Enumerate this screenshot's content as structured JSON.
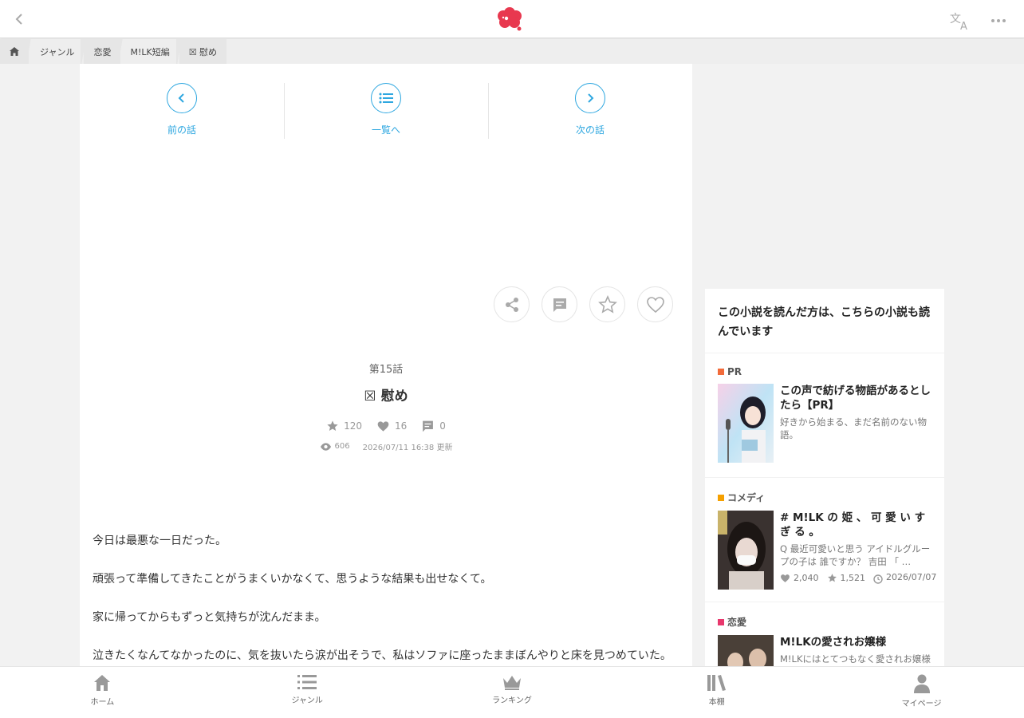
{
  "header": {
    "back_icon": "chevron-left-icon",
    "logo_icon": "red-flower-logo",
    "translate_icon": "translate-icon",
    "more_icon": "more-dots-icon"
  },
  "breadcrumb": {
    "home_icon": "home-icon",
    "items": [
      "ジャンル",
      "恋愛",
      "M!LK短編",
      "☒ 慰め"
    ]
  },
  "episode_nav": {
    "prev_label": "前の話",
    "list_label": "一覧へ",
    "next_label": "次の話"
  },
  "episode": {
    "number": "第15話",
    "title": "☒ 慰め",
    "stars": "120",
    "likes": "16",
    "comments": "0",
    "views": "606",
    "updated": "2026/07/11 16:38 更新"
  },
  "body": {
    "paragraphs": [
      "今日は最悪な一日だった。",
      "頑張って準備してきたことがうまくいかなくて、思うような結果も出せなくて。",
      "家に帰ってからもずっと気持ちが沈んだまま。",
      "泣きたくなんてなかったのに、気を抜いたら涙が出そうで、私はソファに座ったままぼんやりと床を見つめていた。"
    ]
  },
  "sidebar": {
    "heading": "この小説を読んだ方は、こちらの小説も読んでいます",
    "cards": [
      {
        "tag": "PR",
        "tag_color": "#f26b3a",
        "title": "この声で紡げる物語があるとしたら【PR】",
        "desc": "好きから始まる、まだ名前のない物語。"
      },
      {
        "tag": "コメディ",
        "tag_color": "#f5a000",
        "title": "# M!LK の 姫 、 可 愛 い す ぎ る 。",
        "desc": "Q 最近可愛いと思う アイドルグループの子は 誰ですか？ 吉田 「 …",
        "likes": "2,040",
        "stars": "1,521",
        "date": "2026/07/07"
      },
      {
        "tag": "恋愛",
        "tag_color": "#e8386d",
        "title": "M!LKの愛されお嬢様",
        "desc": "M!LKにはとてつもなく愛されお嬢様がいる"
      }
    ]
  },
  "bottom_nav": [
    "ホーム",
    "ジャンル",
    "ランキング",
    "本棚",
    "マイページ"
  ],
  "colors": {
    "accent": "#2ea7e0",
    "logo": "#e8384f"
  }
}
